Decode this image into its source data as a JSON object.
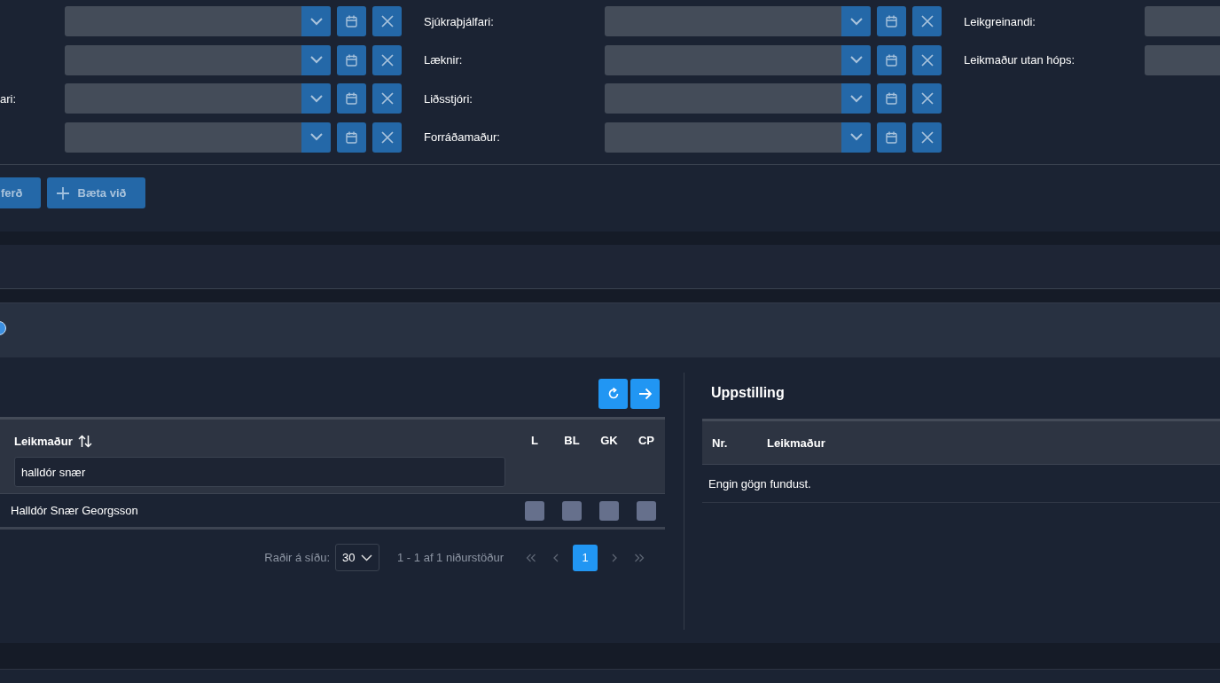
{
  "assignment_columns": [
    {
      "fields": [
        {
          "kind": "full"
        },
        {
          "kind": "full"
        },
        {
          "kind": "full",
          "label": "ari:"
        },
        {
          "kind": "full"
        }
      ]
    },
    {
      "fields": [
        {
          "kind": "full",
          "label": "Sjúkraþjálfari:"
        },
        {
          "kind": "full",
          "label": "Læknir:"
        },
        {
          "kind": "full",
          "label": "Liðsstjóri:"
        },
        {
          "kind": "full",
          "label": "Forráðamaður:"
        }
      ]
    },
    {
      "fields": [
        {
          "kind": "partial",
          "label": "Leikgreinandi:"
        },
        {
          "kind": "partial",
          "label": "Leikmaður utan hóps:"
        }
      ]
    }
  ],
  "action_buttons": [
    {
      "label": "ferð",
      "kind": "text"
    },
    {
      "label": "Bæta við",
      "kind": "add"
    }
  ],
  "option_radio": {
    "checked": true
  },
  "player_table": {
    "name_column": "Leikmaður",
    "filter_value": "halldór snær",
    "flag_columns": [
      "L",
      "BL",
      "GK",
      "CP"
    ],
    "rows": [
      {
        "name": "Halldór Snær Georgsson",
        "flags": [
          {
            "checked": false
          },
          {
            "checked": false
          },
          {
            "checked": false
          },
          {
            "checked": false
          }
        ]
      }
    ],
    "pagination": {
      "rows_per_page_label": "Raðir á síðu:",
      "rows_per_page": "30",
      "summary": "1 - 1 af 1 niðurstöður",
      "pages": [
        {
          "label": "1",
          "selected": true
        }
      ]
    }
  },
  "lineup": {
    "title": "Uppstilling",
    "columns": [
      "Nr.",
      "Leikmaður"
    ],
    "empty_message": "Engin gögn fundust."
  }
}
